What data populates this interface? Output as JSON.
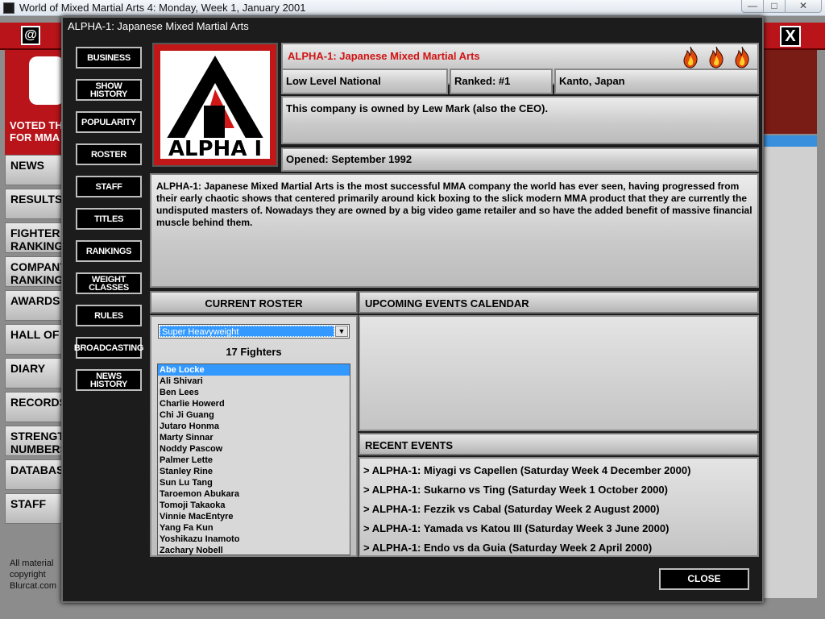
{
  "window": {
    "title": "World of Mixed Martial Arts 4: Monday, Week 1, January 2001",
    "min_glyph": "—",
    "max_glyph": "□",
    "close_glyph": "✕"
  },
  "background": {
    "at_label": "@",
    "x_label": "X",
    "voted_lines": [
      "VOTED THE #",
      "FOR MMA N"
    ],
    "nav": [
      "NEWS",
      "RESULTS",
      "FIGHTER RANKING",
      "COMPANY RANKING",
      "AWARDS",
      "HALL OF F",
      "DIARY",
      "RECORDS",
      "STRENGT NUMBERS",
      "DATABAS",
      "STAFF"
    ],
    "footer": [
      "All material",
      "copyright",
      "Blurcat.com"
    ]
  },
  "dialog": {
    "title": "ALPHA-1: Japanese Mixed Martial Arts",
    "nav_buttons": [
      "BUSINESS",
      "SHOW HISTORY",
      "POPULARITY",
      "ROSTER",
      "STAFF",
      "TITLES",
      "RANKINGS",
      "WEIGHT CLASSES",
      "RULES",
      "BROADCASTING",
      "NEWS HISTORY"
    ],
    "logo_text": "ALPHA I",
    "company_name": "ALPHA-1: Japanese Mixed Martial Arts",
    "company_name_color": "#d11515",
    "level": "Low Level National",
    "ranked": "Ranked: #1",
    "location": "Kanto, Japan",
    "owned": "This company is owned by Lew Mark (also the CEO).",
    "opened": "Opened: September 1992",
    "description": "ALPHA-1: Japanese Mixed Martial Arts is the most successful MMA company the world has ever seen, having progressed from their early chaotic shows that centered primarily around kick boxing to the slick modern MMA product that they are currently the undisputed masters of. Nowadays they are owned by a big video game retailer and so have the added benefit of massive financial muscle behind them.",
    "roster": {
      "header": "CURRENT ROSTER",
      "weight_class": "Super Heavyweight",
      "count": "17 Fighters",
      "fighters": [
        "Abe Locke",
        "Ali Shivari",
        "Ben Lees",
        "Charlie Howerd",
        "Chi Ji Guang",
        "Jutaro Honma",
        "Marty Sinnar",
        "Noddy Pascow",
        "Palmer Lette",
        "Stanley Rine",
        "Sun Lu Tang",
        "Taroemon Abukara",
        "Tomoji Takaoka",
        "Vinnie MacEntyre",
        "Yang Fa Kun",
        "Yoshikazu Inamoto",
        "Zachary Nobell"
      ],
      "selected_index": 0
    },
    "upcoming_header": "UPCOMING EVENTS CALENDAR",
    "recent_header": "RECENT EVENTS",
    "recent_events": [
      "> ALPHA-1: Miyagi vs Capellen (Saturday Week 4 December 2000)",
      "> ALPHA-1: Sukarno vs Ting (Saturday Week 1 October 2000)",
      "> ALPHA-1: Fezzik vs Cabal (Saturday Week 2 August 2000)",
      "> ALPHA-1: Yamada vs Katou III (Saturday Week 3 June 2000)",
      "> ALPHA-1: Endo vs da Guia (Saturday Week 2 April 2000)"
    ],
    "close_label": "CLOSE"
  },
  "icons": {
    "popularity": [
      "flame-icon",
      "flame-icon",
      "flame-icon"
    ],
    "dropdown": "chevron-down-icon"
  }
}
